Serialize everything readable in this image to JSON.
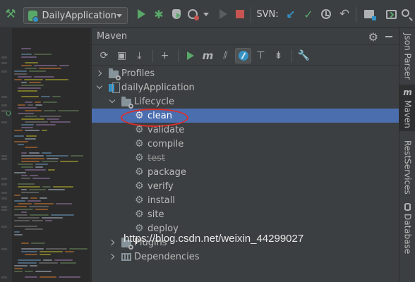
{
  "toolbar": {
    "build_icon": "hammer-icon",
    "run_config": "DailyApplication",
    "svn_label": "SVN:"
  },
  "maven": {
    "title": "Maven",
    "tree": {
      "profiles": "Profiles",
      "project": "dailyApplication",
      "lifecycle": "Lifecycle",
      "phases": [
        "clean",
        "validate",
        "compile",
        "test",
        "package",
        "verify",
        "install",
        "site",
        "deploy"
      ],
      "selected_phase": "clean",
      "skipped_phase": "test",
      "plugins": "Plugins",
      "dependencies": "Dependencies"
    }
  },
  "right_tools": {
    "json_parser": "Json Parser",
    "maven": "Maven",
    "rest_services": "RestServices",
    "database": "Database"
  },
  "watermark": "https://blog.csdn.net/weixin_44299027",
  "colors": {
    "background": "#2b2b2b",
    "panel": "#3c3f41",
    "selection": "#4b6eaf",
    "run_green": "#59a869",
    "annotation_red": "#d9302c"
  }
}
